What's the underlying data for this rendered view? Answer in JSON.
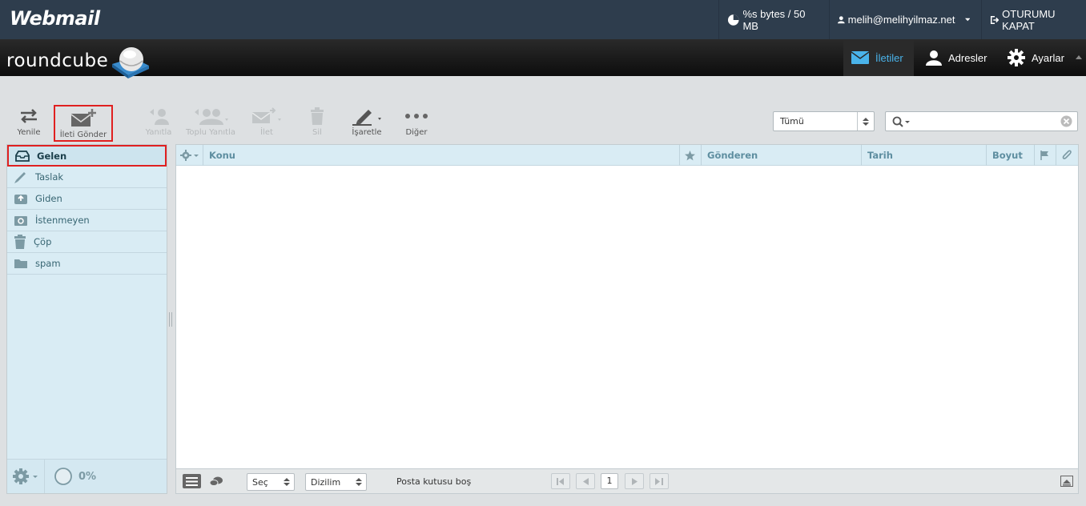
{
  "topbar": {
    "brand": "Webmail",
    "quota": "%s bytes / 50 MB",
    "user": "melih@melihyilmaz.net",
    "logout": "OTURUMU KAPAT"
  },
  "header": {
    "logo": "roundcube",
    "tabs": [
      {
        "label": "İletiler",
        "icon": "mail-icon",
        "active": true
      },
      {
        "label": "Adresler",
        "icon": "person-icon",
        "active": false
      },
      {
        "label": "Ayarlar",
        "icon": "gear-icon",
        "active": false
      }
    ]
  },
  "toolbar": {
    "buttons": [
      {
        "label": "Yenile",
        "icon": "refresh-icon",
        "enabled": true
      },
      {
        "label": "İleti Gönder",
        "icon": "compose-icon",
        "enabled": true
      },
      {
        "label": "Yanıtla",
        "icon": "reply-icon",
        "enabled": false
      },
      {
        "label": "Toplu Yanıtla",
        "icon": "reply-all-icon",
        "enabled": false
      },
      {
        "label": "İlet",
        "icon": "forward-icon",
        "enabled": false
      },
      {
        "label": "Sil",
        "icon": "trash-icon",
        "enabled": false
      },
      {
        "label": "İşaretle",
        "icon": "mark-icon",
        "enabled": true
      },
      {
        "label": "Diğer",
        "icon": "more-icon",
        "enabled": true
      }
    ],
    "filter": "Tümü",
    "search_placeholder": ""
  },
  "folders": {
    "items": [
      {
        "label": "Gelen",
        "icon": "inbox-icon",
        "selected": true
      },
      {
        "label": "Taslak",
        "icon": "pencil-icon",
        "selected": false
      },
      {
        "label": "Giden",
        "icon": "sent-icon",
        "selected": false
      },
      {
        "label": "İstenmeyen",
        "icon": "junk-icon",
        "selected": false
      },
      {
        "label": "Çöp",
        "icon": "trash-icon",
        "selected": false
      },
      {
        "label": "spam",
        "icon": "folder-icon",
        "selected": false
      }
    ],
    "quota_percent": "0%"
  },
  "message_list": {
    "columns": {
      "subject": "Konu",
      "from": "Gönderen",
      "date": "Tarih",
      "size": "Boyut"
    },
    "select_label": "Seç",
    "threads_label": "Dizilim",
    "status": "Posta kutusu boş",
    "page": "1"
  },
  "colors": {
    "topbar": "#2e3d4d",
    "active_tab": "#4ab3ea",
    "folder_bg": "#d9ecf4",
    "highlight": "#e02020"
  }
}
